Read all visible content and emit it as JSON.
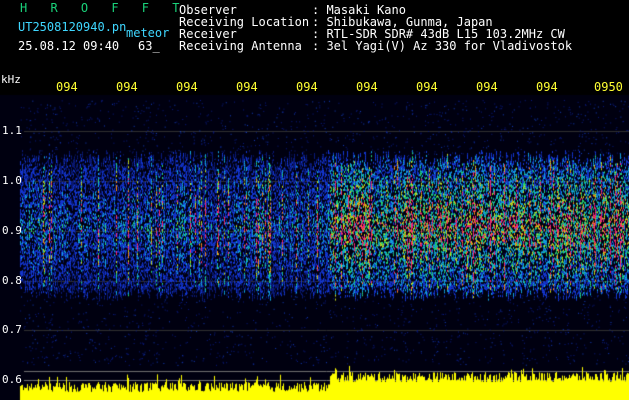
{
  "header": {
    "brand": "H R O F F T",
    "filename": "UT2508120940.pn",
    "mode": "meteor",
    "datetime": "25.08.12 09:40",
    "count": "63_",
    "info": [
      {
        "label": "Observer",
        "value": ": Masaki Kano"
      },
      {
        "label": "Receiving Location",
        "value": ": Shibukawa, Gunma, Japan"
      },
      {
        "label": "Receiver",
        "value": ": RTL-SDR SDR# 43dB L15 103.2MHz CW"
      },
      {
        "label": "Receiving Antenna",
        "value": ": 3el Yagi(V) Az 330 for Vladivostok"
      }
    ]
  },
  "axis": {
    "unit": "kHz",
    "freq_ticks": [
      "1.1",
      "1.0",
      "0.9",
      "0.8",
      "0.7",
      "0.6"
    ],
    "time_ticks": [
      "094",
      "094",
      "094",
      "094",
      "094",
      "094",
      "094",
      "094",
      "094",
      "0950"
    ]
  },
  "colors": {
    "text": "#ffffff",
    "brand": "#19d27a",
    "header_small": "#3fd7ff",
    "ticks": "#ffff33",
    "signal_bar": "#ffff00",
    "signal_baseline": "#00c8ff"
  }
}
